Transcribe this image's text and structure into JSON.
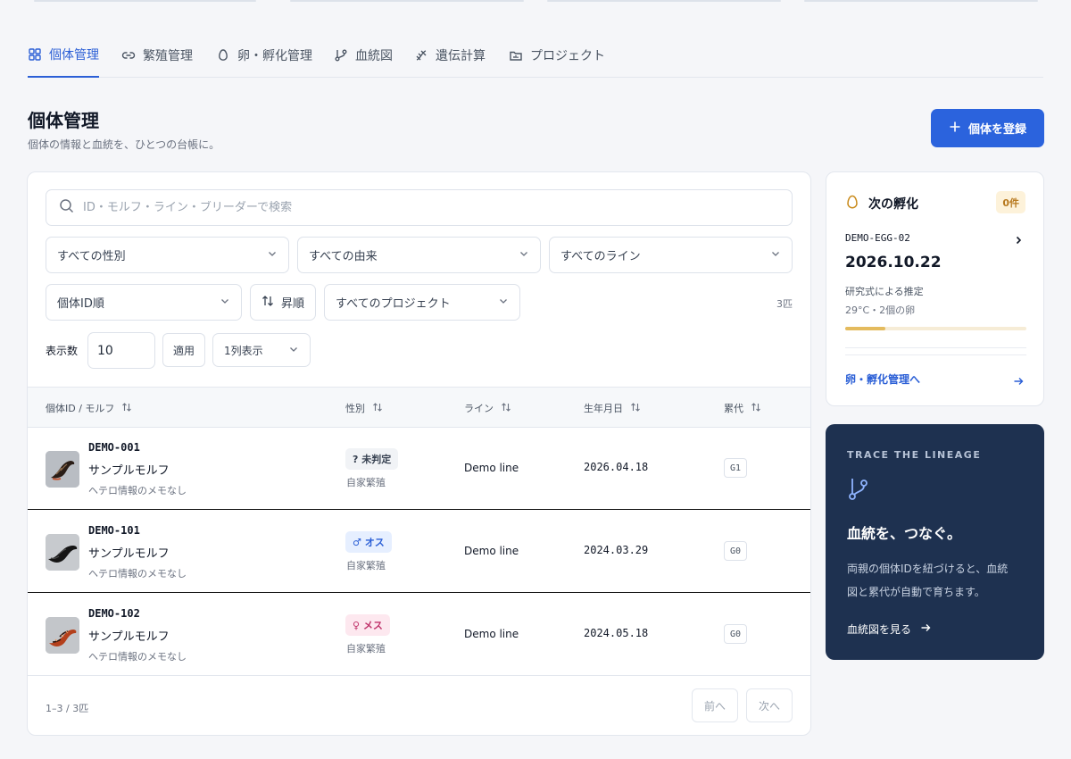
{
  "tabs": [
    {
      "label": "個体管理",
      "icon": "grid-icon"
    },
    {
      "label": "繁殖管理",
      "icon": "link-icon"
    },
    {
      "label": "卵・孵化管理",
      "icon": "egg-icon"
    },
    {
      "label": "血統図",
      "icon": "branch-icon"
    },
    {
      "label": "遺伝計算",
      "icon": "dna-icon"
    },
    {
      "label": "プロジェクト",
      "icon": "folder-icon"
    }
  ],
  "header": {
    "title": "個体管理",
    "subtitle": "個体の情報と血統を、ひとつの台帳に。",
    "register_button": "個体を登録"
  },
  "filters": {
    "search_placeholder": "ID・モルフ・ライン・ブリーダーで検索",
    "sex": "すべての性別",
    "origin": "すべての由来",
    "line": "すべてのライン",
    "sort": "個体ID順",
    "order": "昇順",
    "project": "すべてのプロジェクト",
    "count": "3匹",
    "show_label": "表示数",
    "show_value": "10",
    "apply": "適用",
    "layout": "1列表示"
  },
  "table": {
    "columns": [
      "個体ID / モルフ",
      "性別",
      "ライン",
      "生年月日",
      "累代"
    ],
    "rows": [
      {
        "id": "DEMO-001",
        "morph": "サンプルモルフ",
        "note": "ヘテロ情報のメモなし",
        "sex": "? 未判定",
        "sex_type": "unknown",
        "origin": "自家繁殖",
        "line": "Demo line",
        "birth": "2026.04.18",
        "gen": "G1"
      },
      {
        "id": "DEMO-101",
        "morph": "サンプルモルフ",
        "note": "ヘテロ情報のメモなし",
        "sex": "♂ オス",
        "sex_type": "male",
        "origin": "自家繁殖",
        "line": "Demo line",
        "birth": "2024.03.29",
        "gen": "G0"
      },
      {
        "id": "DEMO-102",
        "morph": "サンプルモルフ",
        "note": "ヘテロ情報のメモなし",
        "sex": "♀ メス",
        "sex_type": "female",
        "origin": "自家繁殖",
        "line": "Demo line",
        "birth": "2024.05.18",
        "gen": "G0"
      }
    ]
  },
  "pagination": {
    "summary": "1–3 / 3匹",
    "prev": "前へ",
    "next": "次へ"
  },
  "hatch": {
    "title": "次の孵化",
    "badge": "0件",
    "egg_id": "DEMO-EGG-02",
    "date": "2026.10.22",
    "method": "研究式による推定",
    "conditions": "29°C・2個の卵",
    "progress": 0.22,
    "link": "卵・孵化管理へ"
  },
  "promo": {
    "eyebrow": "TRACE THE LINEAGE",
    "title": "血統を、つなぐ。",
    "body_line1": "両親の個体IDを紐づけると、血統",
    "body_line2": "図と累代が自動で育ちます。",
    "link": "血統図を見る"
  },
  "colors": {
    "accent": "#2b63dd",
    "promo_bg": "#1e3150",
    "hatch_bar": "#e4bb5e"
  }
}
